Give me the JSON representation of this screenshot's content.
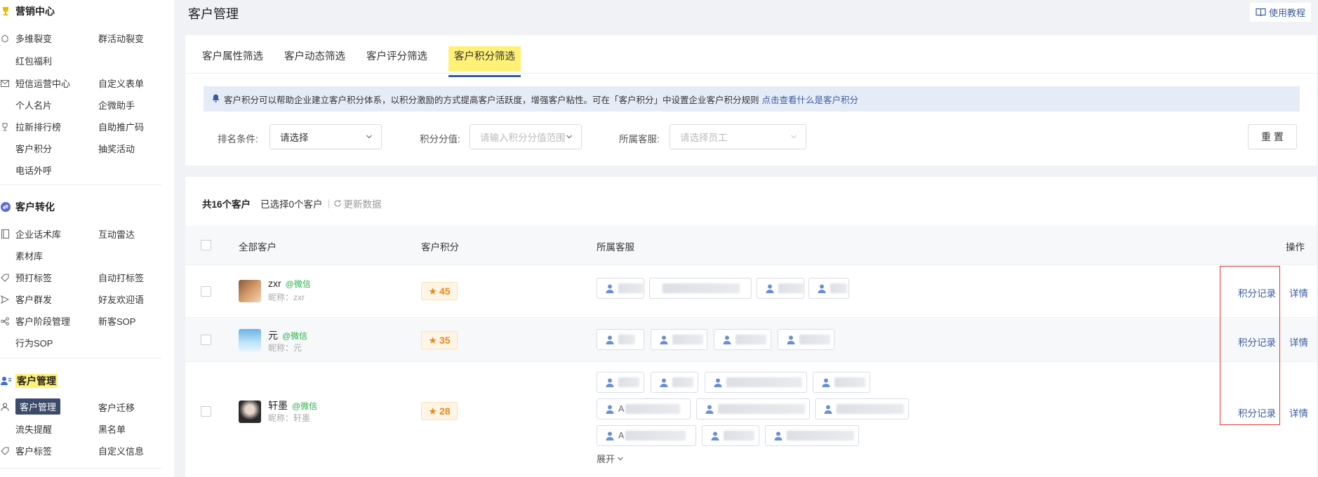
{
  "sidebar": {
    "sections": [
      {
        "title": "营销中心",
        "icon": "trophy-icon",
        "items": [
          {
            "label": "多维裂变",
            "icon": "gift-icon"
          },
          {
            "label": "群活动裂变"
          },
          {
            "label": "红包福利"
          },
          {
            "label": "短信运营中心",
            "icon": "mail-icon"
          },
          {
            "label": "自定义表单"
          },
          {
            "label": "个人名片"
          },
          {
            "label": "企微助手"
          },
          {
            "label": "拉新排行榜",
            "icon": "cup-icon"
          },
          {
            "label": "自助推广码"
          },
          {
            "label": "客户积分"
          },
          {
            "label": "抽奖活动"
          },
          {
            "label": "电话外呼"
          }
        ]
      },
      {
        "title": "客户转化",
        "icon": "convert-icon",
        "items": [
          {
            "label": "企业话术库",
            "icon": "book-icon"
          },
          {
            "label": "互动雷达"
          },
          {
            "label": "素材库"
          },
          {
            "label": "预打标签",
            "icon": "tag-icon"
          },
          {
            "label": "自动打标签"
          },
          {
            "label": "客户群发",
            "icon": "send-icon"
          },
          {
            "label": "好友欢迎语"
          },
          {
            "label": "客户阶段管理",
            "icon": "flow-icon"
          },
          {
            "label": "新客SOP"
          },
          {
            "label": "行为SOP"
          }
        ]
      },
      {
        "title": "客户管理",
        "icon": "users-icon",
        "items": [
          {
            "label": "客户管理",
            "icon": "user-icon",
            "active": true
          },
          {
            "label": "客户迁移"
          },
          {
            "label": "流失提醒"
          },
          {
            "label": "黑名单"
          },
          {
            "label": "客户标签",
            "icon": "tag-icon"
          },
          {
            "label": "自定义信息"
          }
        ]
      }
    ]
  },
  "header": {
    "title": "客户管理",
    "tutorial_label": "使用教程"
  },
  "filter": {
    "tabs": [
      "客户属性筛选",
      "客户动态筛选",
      "客户评分筛选",
      "客户积分筛选"
    ],
    "active_tab": 3,
    "notice_text": "客户积分可以帮助企业建立客户积分体系，以积分激励的方式提高客户活跃度，增强客户粘性。可在「客户积分」中设置企业客户积分规则",
    "notice_link": "点击查看什么是客户积分",
    "sort_label": "排名条件:",
    "sort_value": "请选择",
    "points_label": "积分分值:",
    "points_placeholder": "请输入积分分值范围",
    "staff_label": "所属客服:",
    "staff_placeholder": "请选择员工",
    "reset_label": "重 置"
  },
  "table": {
    "total_text": "共16个客户",
    "selected_text": "已选择0个客户",
    "refresh_label": "更新数据",
    "headers": {
      "customer": "全部客户",
      "points": "客户积分",
      "staff": "所属客服",
      "actions": "操作"
    },
    "rows": [
      {
        "name": "zxr",
        "source": "@微信",
        "nickname": "昵称：zxr",
        "points": "45",
        "record_label": "积分记录",
        "detail_label": "详情"
      },
      {
        "name": "元",
        "source": "@微信",
        "nickname": "昵称：元",
        "points": "35",
        "record_label": "积分记录",
        "detail_label": "详情"
      },
      {
        "name": "轩墨",
        "source": "@微信",
        "nickname": "昵称：轩墨",
        "points": "28",
        "record_label": "积分记录",
        "detail_label": "详情",
        "expand_label": "展开"
      }
    ],
    "partial_chip_texts": [
      "A",
      "A"
    ]
  },
  "colors": {
    "accent": "#3a5ba0",
    "highlight": "#fff176",
    "points_text": "#e88a1c",
    "wechat_green": "#27b24a",
    "annotation_red": "#e53935"
  }
}
